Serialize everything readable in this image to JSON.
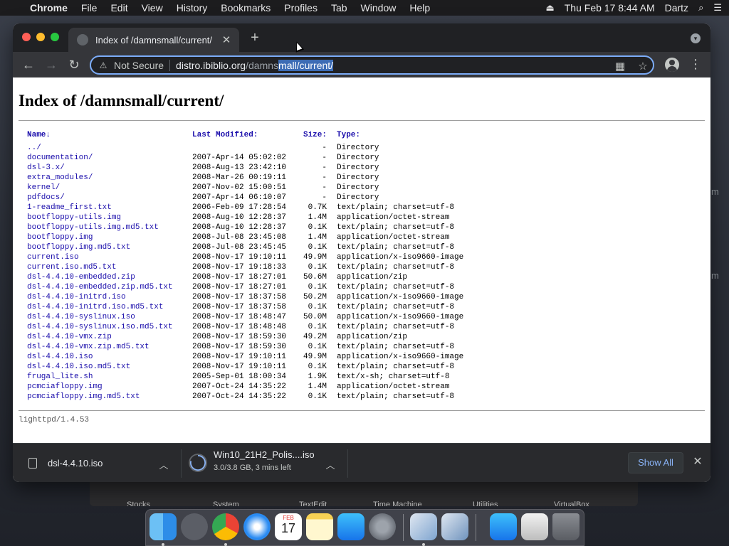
{
  "menubar": {
    "app_name": "Chrome",
    "items": [
      "File",
      "Edit",
      "View",
      "History",
      "Bookmarks",
      "Profiles",
      "Tab",
      "Window",
      "Help"
    ],
    "datetime": "Thu Feb 17  8:44 AM",
    "user": "Dartz"
  },
  "browser": {
    "tab_title": "Index of /damnsmall/current/",
    "omnibox": {
      "security_label": "Not Secure",
      "url_host": "distro.ibiblio.org",
      "url_path_unselected": "/damns",
      "url_path_selected": "mall/current/"
    }
  },
  "page": {
    "title": "Index of /damnsmall/current/",
    "headers": {
      "name": "Name↓",
      "modified": "Last Modified:",
      "size": "Size:",
      "type": "Type:"
    },
    "rows": [
      {
        "name": "../",
        "modified": "",
        "size": "-",
        "type": "Directory"
      },
      {
        "name": "documentation/",
        "modified": "2007-Apr-14 05:02:02",
        "size": "-",
        "type": "Directory"
      },
      {
        "name": "dsl-3.x/",
        "modified": "2008-Aug-13 23:42:10",
        "size": "-",
        "type": "Directory"
      },
      {
        "name": "extra_modules/",
        "modified": "2008-Mar-26 00:19:11",
        "size": "-",
        "type": "Directory"
      },
      {
        "name": "kernel/",
        "modified": "2007-Nov-02 15:00:51",
        "size": "-",
        "type": "Directory"
      },
      {
        "name": "pdfdocs/",
        "modified": "2007-Apr-14 06:10:07",
        "size": "-",
        "type": "Directory"
      },
      {
        "name": "1-readme_first.txt",
        "modified": "2006-Feb-09 17:28:54",
        "size": "0.7K",
        "type": "text/plain; charset=utf-8"
      },
      {
        "name": "bootfloppy-utils.img",
        "modified": "2008-Aug-10 12:28:37",
        "size": "1.4M",
        "type": "application/octet-stream"
      },
      {
        "name": "bootfloppy-utils.img.md5.txt",
        "modified": "2008-Aug-10 12:28:37",
        "size": "0.1K",
        "type": "text/plain; charset=utf-8"
      },
      {
        "name": "bootfloppy.img",
        "modified": "2008-Jul-08 23:45:08",
        "size": "1.4M",
        "type": "application/octet-stream"
      },
      {
        "name": "bootfloppy.img.md5.txt",
        "modified": "2008-Jul-08 23:45:45",
        "size": "0.1K",
        "type": "text/plain; charset=utf-8"
      },
      {
        "name": "current.iso",
        "modified": "2008-Nov-17 19:10:11",
        "size": "49.9M",
        "type": "application/x-iso9660-image"
      },
      {
        "name": "current.iso.md5.txt",
        "modified": "2008-Nov-17 19:18:33",
        "size": "0.1K",
        "type": "text/plain; charset=utf-8"
      },
      {
        "name": "dsl-4.4.10-embedded.zip",
        "modified": "2008-Nov-17 18:27:01",
        "size": "50.6M",
        "type": "application/zip"
      },
      {
        "name": "dsl-4.4.10-embedded.zip.md5.txt",
        "modified": "2008-Nov-17 18:27:01",
        "size": "0.1K",
        "type": "text/plain; charset=utf-8"
      },
      {
        "name": "dsl-4.4.10-initrd.iso",
        "modified": "2008-Nov-17 18:37:58",
        "size": "50.2M",
        "type": "application/x-iso9660-image"
      },
      {
        "name": "dsl-4.4.10-initrd.iso.md5.txt",
        "modified": "2008-Nov-17 18:37:58",
        "size": "0.1K",
        "type": "text/plain; charset=utf-8"
      },
      {
        "name": "dsl-4.4.10-syslinux.iso",
        "modified": "2008-Nov-17 18:48:47",
        "size": "50.0M",
        "type": "application/x-iso9660-image"
      },
      {
        "name": "dsl-4.4.10-syslinux.iso.md5.txt",
        "modified": "2008-Nov-17 18:48:48",
        "size": "0.1K",
        "type": "text/plain; charset=utf-8"
      },
      {
        "name": "dsl-4.4.10-vmx.zip",
        "modified": "2008-Nov-17 18:59:30",
        "size": "49.2M",
        "type": "application/zip"
      },
      {
        "name": "dsl-4.4.10-vmx.zip.md5.txt",
        "modified": "2008-Nov-17 18:59:30",
        "size": "0.1K",
        "type": "text/plain; charset=utf-8"
      },
      {
        "name": "dsl-4.4.10.iso",
        "modified": "2008-Nov-17 19:10:11",
        "size": "49.9M",
        "type": "application/x-iso9660-image"
      },
      {
        "name": "dsl-4.4.10.iso.md5.txt",
        "modified": "2008-Nov-17 19:10:11",
        "size": "0.1K",
        "type": "text/plain; charset=utf-8"
      },
      {
        "name": "frugal_lite.sh",
        "modified": "2005-Sep-01 18:00:34",
        "size": "1.9K",
        "type": "text/x-sh; charset=utf-8"
      },
      {
        "name": "pcmciafloppy.img",
        "modified": "2007-Oct-24 14:35:22",
        "size": "1.4M",
        "type": "application/octet-stream"
      },
      {
        "name": "pcmciafloppy.img.md5.txt",
        "modified": "2007-Oct-24 14:35:22",
        "size": "0.1K",
        "type": "text/plain; charset=utf-8"
      }
    ],
    "footer": "lighttpd/1.4.53"
  },
  "downloads": {
    "items": [
      {
        "name": "dsl-4.4.10.iso",
        "status": ""
      },
      {
        "name": "Win10_21H2_Polis....iso",
        "status": "3.0/3.8 GB, 3 mins left",
        "progress": 0.79
      }
    ],
    "show_all_label": "Show All"
  },
  "background": {
    "labels": [
      "Stocks",
      "System",
      "TextEdit",
      "Time Machine",
      "Utilities",
      "VirtualBox"
    ],
    "side_char": "m"
  },
  "dock": {
    "apps": [
      "finder-icon",
      "launchpad-icon",
      "chrome-icon",
      "safari-icon",
      "calendar-icon",
      "notes-icon",
      "app-store-icon",
      "system-preferences-icon",
      "virtualbox-icon",
      "virtualbox-vm-icon",
      "app-store-download-icon",
      "preview-icon",
      "trash-icon"
    ],
    "calendar": {
      "month": "FEB",
      "day": "17"
    }
  },
  "colors": {
    "link": "#1a0dab",
    "chrome_dark": "#202124",
    "omnibox_focus": "#7cacf8",
    "selection": "#3d6cb5"
  }
}
